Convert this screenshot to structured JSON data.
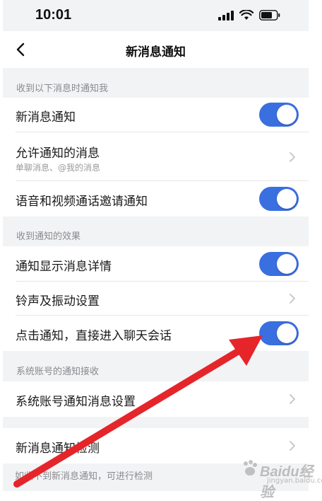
{
  "status_bar": {
    "time": "10:01"
  },
  "nav": {
    "title": "新消息通知"
  },
  "sections": {
    "receive_header": "收到以下消息时通知我",
    "effect_header": "收到通知的效果",
    "system_header": "系统账号的通知接收"
  },
  "rows": {
    "new_message_notify": {
      "label": "新消息通知",
      "enabled": true
    },
    "allowed_messages": {
      "label": "允许通知的消息",
      "sub": "单聊消息、@我的消息"
    },
    "call_invite_notify": {
      "label": "语音和视频通话邀请通知",
      "enabled": true
    },
    "show_details": {
      "label": "通知显示消息详情",
      "enabled": true
    },
    "ring_vibrate": {
      "label": "铃声及振动设置"
    },
    "tap_open_chat": {
      "label": "点击通知，直接进入聊天会话",
      "enabled": true
    },
    "system_account": {
      "label": "系统账号通知消息设置"
    },
    "notify_check": {
      "label": "新消息通知检测"
    }
  },
  "footer": {
    "note": "如收不到新消息通知，可进行检测"
  },
  "watermark": {
    "text": "Baidu经验",
    "sub": "jingyan.baidu.com"
  },
  "colors": {
    "toggle_on": "#3a6fe0",
    "annotation_arrow": "#e5252a",
    "background": "#f2f3f5"
  },
  "icons": {
    "back": "chevron-left-icon",
    "chevron": "chevron-right-icon",
    "signal": "signal-icon",
    "wifi": "wifi-icon",
    "battery": "battery-icon"
  }
}
